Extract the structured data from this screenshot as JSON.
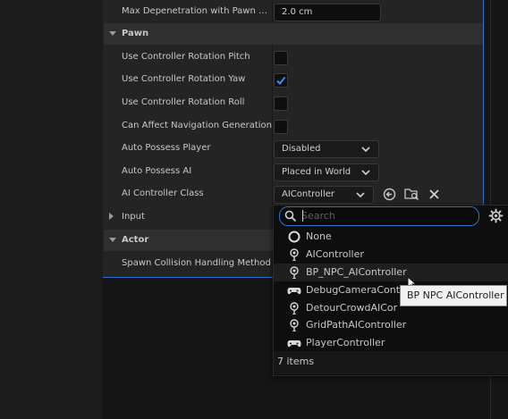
{
  "rows": {
    "max_depenetration": {
      "label": "Max Depenetration with Pawn a...",
      "value": "2.0 cm"
    },
    "pawn_category": "Pawn",
    "use_pitch": {
      "label": "Use Controller Rotation Pitch",
      "checked": false
    },
    "use_yaw": {
      "label": "Use Controller Rotation Yaw",
      "checked": true
    },
    "use_roll": {
      "label": "Use Controller Rotation Roll",
      "checked": false
    },
    "can_affect_nav": {
      "label": "Can Affect Navigation Generation",
      "checked": false
    },
    "auto_possess_player": {
      "label": "Auto Possess Player",
      "value": "Disabled"
    },
    "auto_possess_ai": {
      "label": "Auto Possess AI",
      "value": "Placed in World"
    },
    "ai_controller_class": {
      "label": "AI Controller Class",
      "value": "AIController"
    },
    "input_category": "Input",
    "actor_category": "Actor",
    "spawn_collision": {
      "label": "Spawn Collision Handling Method"
    }
  },
  "popup": {
    "search_placeholder": "Search",
    "items": [
      {
        "name": "None",
        "icon": "none-circle-icon"
      },
      {
        "name": "AIController",
        "icon": "ai-controller-icon"
      },
      {
        "name": "BP_NPC_AIController",
        "icon": "ai-controller-icon"
      },
      {
        "name": "DebugCameraCont",
        "icon": "gamepad-icon"
      },
      {
        "name": "DetourCrowdAICor",
        "icon": "ai-controller-icon"
      },
      {
        "name": "GridPathAIController",
        "icon": "ai-controller-icon"
      },
      {
        "name": "PlayerController",
        "icon": "gamepad-icon"
      }
    ],
    "count_text": "7 items"
  },
  "tooltip": "BP NPC AIController",
  "colors": {
    "accent": "#2e73d1",
    "check": "#3b8ff0"
  }
}
